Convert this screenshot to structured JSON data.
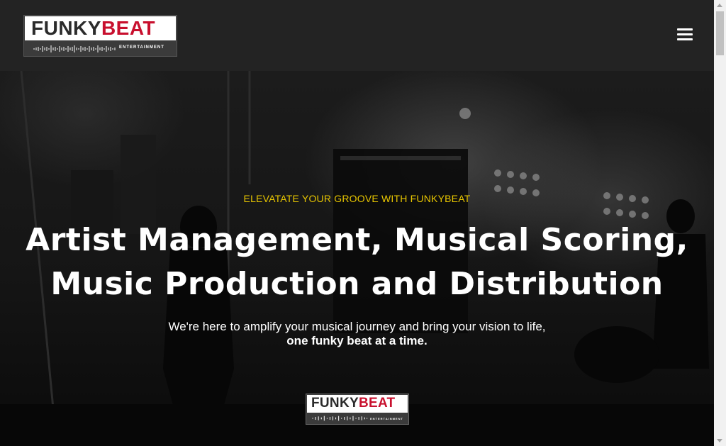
{
  "header": {
    "logo": {
      "word_part1": "FUNKY",
      "word_part2": "BEAT",
      "subtitle": "ENTERTAINMENT"
    },
    "menu_icon": "hamburger-menu-icon"
  },
  "hero": {
    "eyebrow": "ELEVATATE YOUR GROOVE WITH FUNKYBEAT",
    "headline_line1": "Artist Management, Musical Scoring,",
    "headline_line2": "Music Production and Distribution",
    "subtext_line1": "We're here to amplify your musical journey and bring your vision to life,",
    "subtext_line2": "one funky beat at a time.",
    "logo": {
      "word_part1": "FUNKY",
      "word_part2": "BEAT",
      "subtitle": "ENTERTAINMENT"
    }
  },
  "colors": {
    "header_bg": "#232323",
    "accent_yellow": "#e8c600",
    "brand_red": "#c8102e"
  }
}
